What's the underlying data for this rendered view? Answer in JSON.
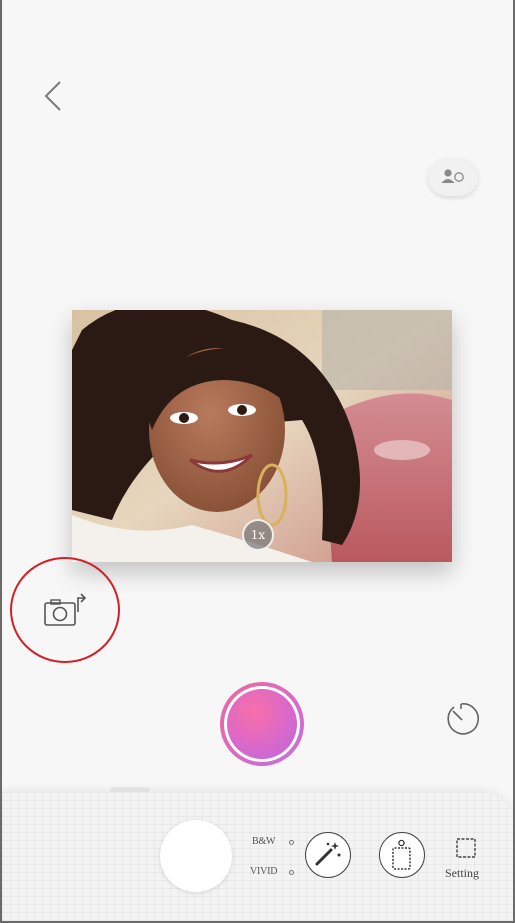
{
  "top": {
    "back_icon": "chevron-left-icon",
    "portrait_icon": "portrait-mode-icon"
  },
  "preview": {
    "zoom_label": "1x"
  },
  "controls": {
    "flip_icon": "camera-flip-icon",
    "shutter_icon": "shutter-button",
    "timer_icon": "timer-icon",
    "accent_gradient": [
      "#f0679f",
      "#c46fe0"
    ],
    "highlight_color": "#d32027"
  },
  "panel": {
    "bw_label": "B&W",
    "vivid_label": "VIVID",
    "effects_icon": "magic-wand-icon",
    "frame_icon": "frame-print-icon",
    "setting_icon": "setting-square-icon",
    "setting_label": "Setting"
  }
}
